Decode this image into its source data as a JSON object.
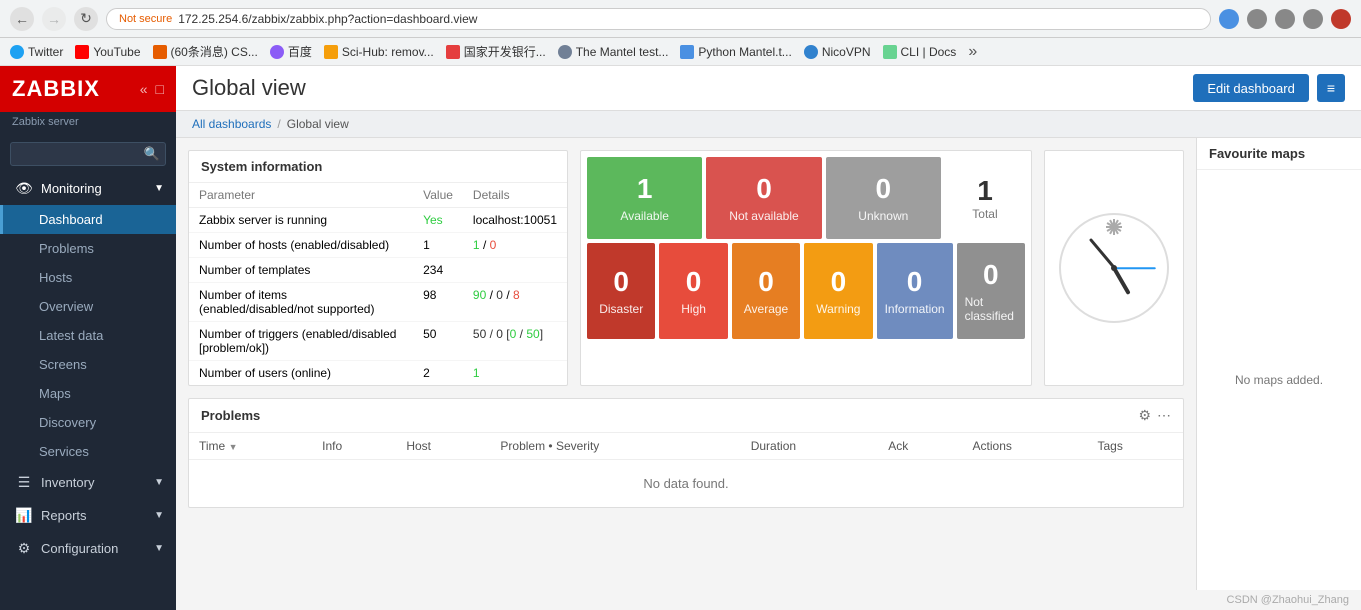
{
  "browser": {
    "back_btn": "←",
    "forward_btn": "→",
    "reload_btn": "↻",
    "warning_text": "Not secure",
    "url": "172.25.254.6/zabbix/zabbix.php?action=dashboard.view",
    "bookmarks": [
      {
        "icon_color": "#1da1f2",
        "label": "Twitter"
      },
      {
        "icon_color": "#ff0000",
        "label": "YouTube"
      },
      {
        "icon_color": "#e65c00",
        "label": "(60条消息) CS..."
      },
      {
        "icon_color": "#8b5cf6",
        "label": "百度"
      },
      {
        "icon_color": "#f59e0b",
        "label": "Sci-Hub: remov..."
      },
      {
        "icon_color": "#e53e3e",
        "label": "国家开发银行..."
      },
      {
        "icon_color": "#718096",
        "label": "The Mantel test..."
      },
      {
        "icon_color": "#4a90e2",
        "label": "Python Mantel.t..."
      },
      {
        "icon_color": "#3182ce",
        "label": "NicoVPN"
      },
      {
        "icon_color": "#68d391",
        "label": "CLI | Docs"
      }
    ]
  },
  "sidebar": {
    "logo": "ZABBIX",
    "server": "Zabbix server",
    "search_placeholder": "",
    "nav": [
      {
        "section": "Monitoring",
        "icon": "👁",
        "expanded": true,
        "items": [
          "Dashboard",
          "Problems",
          "Hosts",
          "Overview",
          "Latest data",
          "Screens",
          "Maps",
          "Discovery",
          "Services"
        ]
      },
      {
        "section": "Inventory",
        "icon": "☰",
        "expanded": false,
        "items": []
      },
      {
        "section": "Reports",
        "icon": "📊",
        "expanded": false,
        "items": []
      },
      {
        "section": "Configuration",
        "icon": "⚙",
        "expanded": false,
        "items": []
      }
    ],
    "active_item": "Dashboard"
  },
  "header": {
    "title": "Global view",
    "edit_btn": "Edit dashboard",
    "menu_btn": "≡"
  },
  "breadcrumb": {
    "all_dashboards": "All dashboards",
    "separator": "/",
    "current": "Global view"
  },
  "system_info": {
    "widget_title": "System information",
    "col_param": "Parameter",
    "col_value": "Value",
    "col_details": "Details",
    "rows": [
      {
        "param": "Zabbix server is running",
        "value": "Yes",
        "value_color": "green",
        "details": "localhost:10051"
      },
      {
        "param": "Number of hosts (enabled/disabled)",
        "value": "1",
        "details": "1 / 0",
        "details_color": "mixed"
      },
      {
        "param": "Number of templates",
        "value": "234",
        "details": ""
      },
      {
        "param": "Number of items (enabled/disabled/not supported)",
        "value": "98",
        "details": "90 / 0 / 8",
        "details_color": "mixed"
      },
      {
        "param": "Number of triggers (enabled/disabled [problem/ok])",
        "value": "50",
        "details": "50 / 0 [0 / 50]",
        "details_color": "mixed"
      },
      {
        "param": "Number of users (online)",
        "value": "2",
        "details": "1",
        "details_color": "green"
      }
    ]
  },
  "host_availability": {
    "top_row": [
      {
        "count": 1,
        "label": "Available",
        "color": "green"
      },
      {
        "count": 0,
        "label": "Not available",
        "color": "red"
      },
      {
        "count": 0,
        "label": "Unknown",
        "color": "gray"
      }
    ],
    "total": {
      "count": 1,
      "label": "Total"
    },
    "bottom_row": [
      {
        "count": 0,
        "label": "Disaster",
        "color": "disaster"
      },
      {
        "count": 0,
        "label": "High",
        "color": "high"
      },
      {
        "count": 0,
        "label": "Average",
        "color": "average"
      },
      {
        "count": 0,
        "label": "Warning",
        "color": "warning"
      },
      {
        "count": 0,
        "label": "Information",
        "color": "information"
      },
      {
        "count": 0,
        "label": "Not classified",
        "color": "not-classified"
      }
    ]
  },
  "problems": {
    "widget_title": "Problems",
    "columns": [
      {
        "label": "Time",
        "sort": "▼"
      },
      {
        "label": "Info",
        "sort": ""
      },
      {
        "label": "Host",
        "sort": ""
      },
      {
        "label": "Problem • Severity",
        "sort": ""
      },
      {
        "label": "Duration",
        "sort": ""
      },
      {
        "label": "Ack",
        "sort": ""
      },
      {
        "label": "Actions",
        "sort": ""
      },
      {
        "label": "Tags",
        "sort": ""
      }
    ],
    "no_data": "No data found."
  },
  "favourite_maps": {
    "title": "Favourite maps",
    "no_maps": "No maps added."
  },
  "watermark": "CSDN @Zhaohui_Zhang"
}
